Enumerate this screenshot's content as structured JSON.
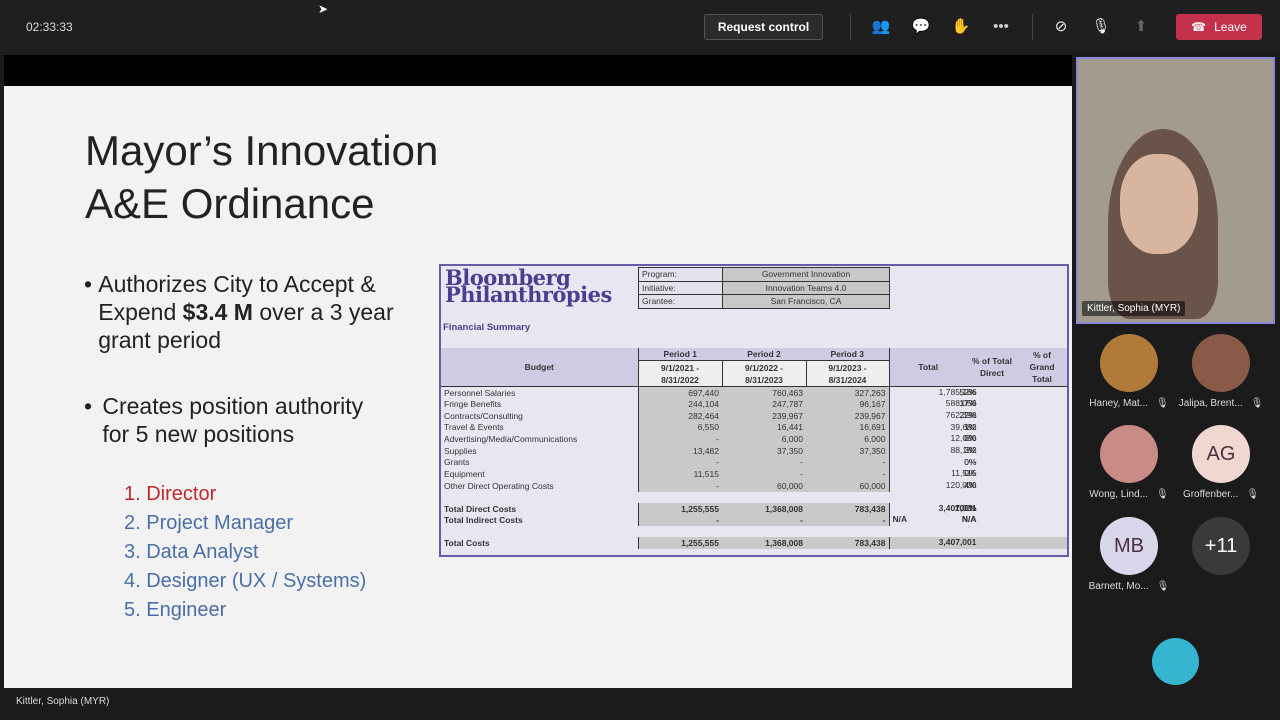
{
  "topbar": {
    "timer": "02:33:33",
    "request_control": "Request control",
    "leave": "Leave",
    "icons": [
      "people-icon",
      "chat-icon",
      "raise-hand-icon",
      "more-icon",
      "camera-off-icon",
      "mic-off-icon",
      "share-icon",
      "phone-hangup-icon"
    ]
  },
  "slide": {
    "title_line1": "Mayor’s Innovation",
    "title_line2": "A&E Ordinance",
    "bullet1_pre": "Authorizes City to Accept & Expend ",
    "bullet1_bold": "$3.4 M",
    "bullet1_post": " over a 3 year grant period",
    "bullet2": "Creates position authority for 5 new positions",
    "positions": [
      "1.  Director",
      "2.  Project Manager",
      "3.  Data Analyst",
      "4.  Designer (UX / Systems)",
      "5.   Engineer"
    ]
  },
  "table": {
    "logo_line1": "Bloomberg",
    "logo_line2": "Philanthropies",
    "meta": [
      {
        "k": "Program:",
        "v": "Government Innovation"
      },
      {
        "k": "Initiative:",
        "v": "Innovation Teams 4.0"
      },
      {
        "k": "Grantee:",
        "v": "San Francisco, CA"
      }
    ],
    "financial_summary": "Financial Summary",
    "headers": {
      "budget": "Budget",
      "p1": "Period 1",
      "p2": "Period 2",
      "p3": "Period 3",
      "d1": "9/1/2021 - 8/31/2022",
      "d2": "9/1/2022 - 8/31/2023",
      "d3": "9/1/2023 - 8/31/2024",
      "total": "Total",
      "pct_direct": "% of Total Direct",
      "pct_grand": "% of Grand Total"
    },
    "rows": [
      [
        "Personnel Salaries",
        "697,440",
        "760,463",
        "327,263",
        "1,785,166",
        "52%",
        "52%"
      ],
      [
        "Fringe Benefits",
        "244,104",
        "247,787",
        "96,167",
        "588,058",
        "17%",
        "17%"
      ],
      [
        "Contracts/Consulting",
        "282,464",
        "239,967",
        "239,967",
        "762,398",
        "22%",
        "22%"
      ],
      [
        "Travel & Events",
        "6,550",
        "16,441",
        "16,691",
        "39,682",
        "1%",
        "1%"
      ],
      [
        "Advertising/Media/Communications",
        "-",
        "6,000",
        "6,000",
        "12,000",
        "0%",
        "0%"
      ],
      [
        "Supplies",
        "13,482",
        "37,350",
        "37,350",
        "88,182",
        "3%",
        "3%"
      ],
      [
        "Grants",
        "-",
        "-",
        "-",
        "-",
        "0%",
        "0%"
      ],
      [
        "Equipment",
        "11,515",
        "-",
        "-",
        "11,515",
        "0%",
        "0%"
      ],
      [
        "Other Direct Operating Costs",
        "-",
        "60,000",
        "60,000",
        "120,000",
        "4%",
        "4%"
      ]
    ],
    "total_direct": [
      "Total Direct Costs",
      "1,255,555",
      "1,368,008",
      "783,438",
      "3,407,001",
      "100%",
      "100%"
    ],
    "total_indirect": [
      "Total Indirect Costs",
      "-",
      "-",
      "-",
      "N/A",
      "N/A",
      "N/A"
    ],
    "total_costs": [
      "Total Costs",
      "1,255,555",
      "1,368,008",
      "783,438",
      "3,407,001"
    ]
  },
  "presenter": {
    "name": "Kittler, Sophia (MYR)"
  },
  "participants": [
    {
      "name": "Haney, Mat...",
      "initials": "",
      "color": "#b07a3a"
    },
    {
      "name": "Jalipa, Brent...",
      "initials": "",
      "color": "#8a5a48"
    },
    {
      "name": "Wong, Lind...",
      "initials": "",
      "color": "#c98b86"
    },
    {
      "name": "Groffenber...",
      "initials": "AG",
      "color": "#f0d7d0"
    },
    {
      "name": "Barnett, Mo...",
      "initials": "MB",
      "color": "#d8d6ea"
    },
    {
      "name": "",
      "initials": "+11",
      "color": "#3a3a3a"
    }
  ],
  "bottombar": {
    "name": "Kittler, Sophia (MYR)"
  }
}
